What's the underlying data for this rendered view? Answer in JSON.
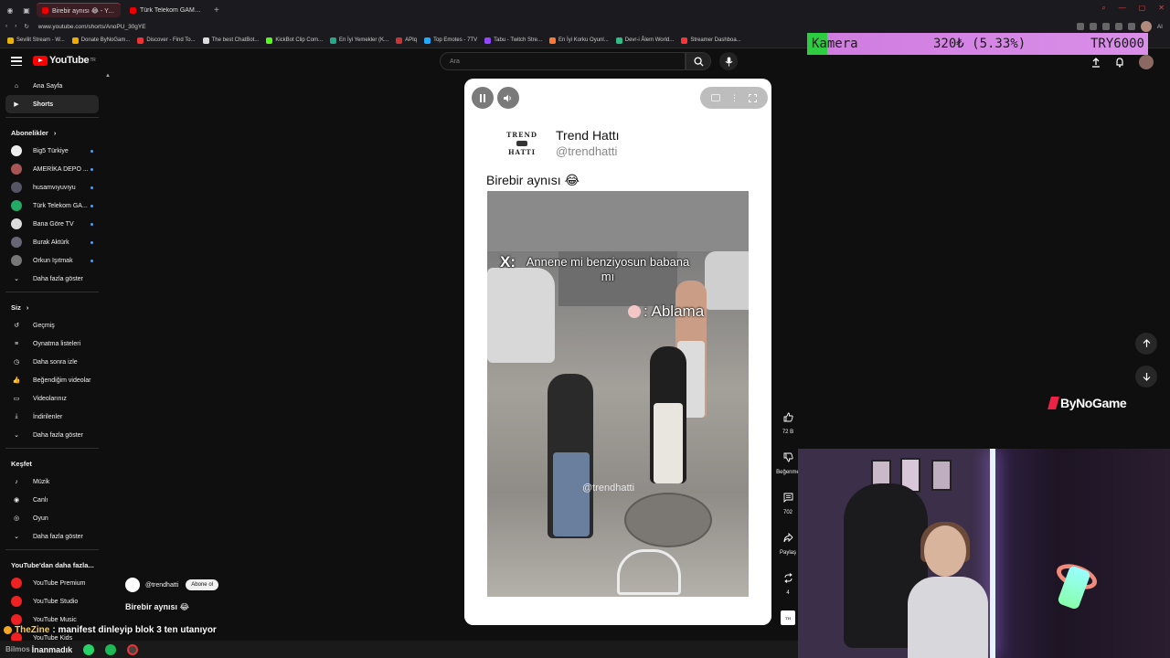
{
  "browser": {
    "tabs": [
      {
        "label": "Birebir aynısı 😂 - YouTube",
        "active": true
      },
      {
        "label": "Türk Telekom GAMEON - ",
        "active": false
      }
    ],
    "address": "www.youtube.com/shorts/AnoPU_30gYE",
    "right_label": "AI",
    "bookmarks": [
      {
        "label": "Sevilit Stream - W...",
        "color": "#e8b400"
      },
      {
        "label": "Donate ByNoGam...",
        "color": "#f2a900"
      },
      {
        "label": "Discover - Find To...",
        "color": "#e33"
      },
      {
        "label": "The best ChatBot...",
        "color": "#ddd"
      },
      {
        "label": "KickBot Clip Com...",
        "color": "#53fc18"
      },
      {
        "label": "En İyi Yemekler (K...",
        "color": "#2a8"
      },
      {
        "label": "APIq",
        "color": "#c33"
      },
      {
        "label": "Top Emotes - 7TV",
        "color": "#2af"
      },
      {
        "label": "Tabu - Twitch Stre...",
        "color": "#9146ff"
      },
      {
        "label": "En İyi Korku Oyunl...",
        "color": "#f73"
      },
      {
        "label": "Devr-i Âlem World...",
        "color": "#3b8"
      },
      {
        "label": "Streamer Dashboa...",
        "color": "#f33"
      }
    ]
  },
  "overlay": {
    "kamera_label": "Kamera",
    "kamera_amount": "320₺ (5.33%)",
    "kamera_goal": "TRY6000",
    "sponsor": "ByNoGame"
  },
  "youtube": {
    "logo": "YouTube",
    "logo_region": "TR",
    "search_placeholder": "Ara"
  },
  "sidebar": {
    "main": [
      {
        "label": "Ana Sayfa",
        "icon": "home-icon",
        "active": false
      },
      {
        "label": "Shorts",
        "icon": "shorts-icon",
        "active": true
      }
    ],
    "subs_header": "Abonelikler",
    "subscriptions": [
      {
        "label": "Big5 Türkiye",
        "color": "#eee"
      },
      {
        "label": "AMERİKA DEPO ...",
        "color": "#a55"
      },
      {
        "label": "husamvıyuvıyu",
        "color": "#556"
      },
      {
        "label": "Türk Telekom GA...",
        "color": "#2a6"
      },
      {
        "label": "Bana Göre TV",
        "color": "#ddd"
      },
      {
        "label": "Burak Aktürk",
        "color": "#667"
      },
      {
        "label": "Orkun Işıtmak",
        "color": "#777"
      }
    ],
    "subs_more": "Daha fazla göster",
    "you_header": "Siz",
    "you": [
      {
        "label": "Geçmiş",
        "icon": "history-icon"
      },
      {
        "label": "Oynatma listeleri",
        "icon": "playlists-icon"
      },
      {
        "label": "Daha sonra izle",
        "icon": "watch-later-icon"
      },
      {
        "label": "Beğendiğim videolar",
        "icon": "liked-icon"
      },
      {
        "label": "Videolarınız",
        "icon": "your-videos-icon"
      },
      {
        "label": "İndirilenler",
        "icon": "downloads-icon"
      },
      {
        "label": "Daha fazla göster",
        "icon": "chevron-down-icon"
      }
    ],
    "explore_header": "Keşfet",
    "explore": [
      {
        "label": "Müzik",
        "icon": "music-icon"
      },
      {
        "label": "Canlı",
        "icon": "live-icon"
      },
      {
        "label": "Oyun",
        "icon": "gaming-icon"
      },
      {
        "label": "Daha fazla göster",
        "icon": "chevron-down-icon"
      }
    ],
    "more_header": "YouTube'dan daha fazla...",
    "more": [
      {
        "label": "YouTube Premium"
      },
      {
        "label": "YouTube Studio"
      },
      {
        "label": "YouTube Music"
      },
      {
        "label": "YouTube Kids"
      }
    ]
  },
  "short": {
    "brand_line1": "TREND",
    "brand_line2": "HATTI",
    "channel_name": "Trend Hattı",
    "channel_handle": "@trendhatti",
    "post_title": "Birebir aynısı 😂",
    "caption_x": "X:",
    "caption_q": "Annene mi benziyosun babana mı",
    "caption_a": ": Ablama",
    "watermark": "@trendhatti"
  },
  "actions": {
    "likes": "72 B",
    "dislike": "Beğenme",
    "comments": "702",
    "share": "Paylaş",
    "remix": "4"
  },
  "info": {
    "channel": "@trendhatti",
    "subscribe": "Abone ol",
    "title": "Birebir aynısı 😂"
  },
  "chat": {
    "user": "TheZine",
    "message": ": manifest dinleyip blok 3 ten utanıyor"
  },
  "taskbar": {
    "label": "İnanmadık",
    "prefix": "Bilmos"
  }
}
